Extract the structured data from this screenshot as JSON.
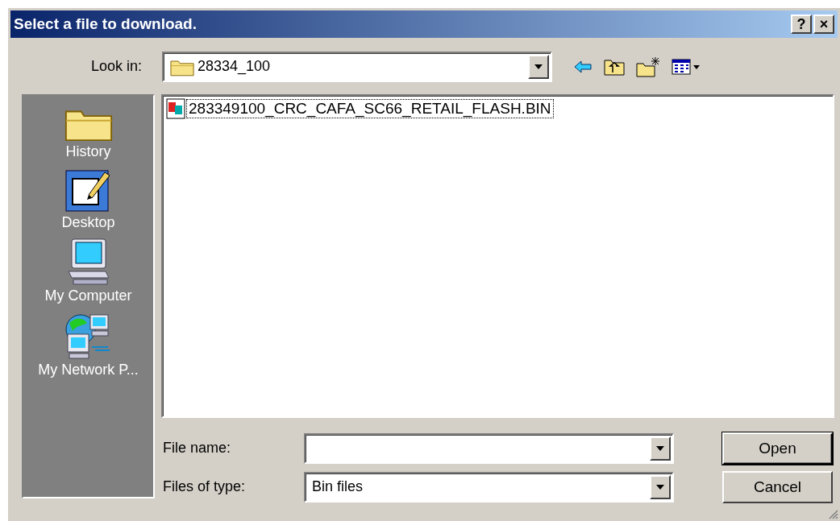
{
  "window": {
    "title": "Select a file to download.",
    "buttons": [
      "?",
      "×"
    ]
  },
  "look_in": {
    "label": "Look in:",
    "value": "28334_100"
  },
  "places": [
    {
      "kind": "history",
      "label": "History"
    },
    {
      "kind": "desktop",
      "label": "Desktop"
    },
    {
      "kind": "computer",
      "label": "My Computer"
    },
    {
      "kind": "network",
      "label": "My Network P..."
    }
  ],
  "files": [
    {
      "name": "283349100_CRC_CAFA_SC66_RETAIL_FLASH.BIN",
      "selected": false,
      "focused": true
    }
  ],
  "file_name": {
    "label": "File name:"
  },
  "file_type": {
    "label": "Files of type:",
    "value": "Bin files"
  },
  "buttons": [
    {
      "label": "Open",
      "default": true
    },
    {
      "label": "Cancel",
      "default": false
    }
  ]
}
